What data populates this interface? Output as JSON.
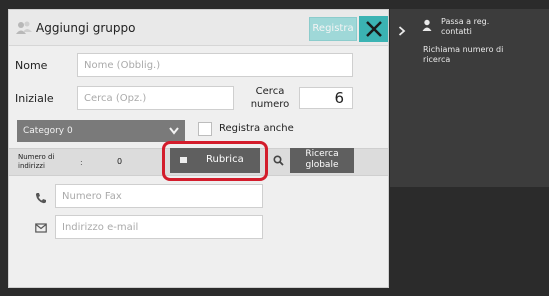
{
  "title_bar": {
    "title": "Aggiungi gruppo",
    "register_button": "Registra",
    "close_icon": "close-icon"
  },
  "form": {
    "name_label": "Nome",
    "name_placeholder": "Nome (Obblig.)",
    "initial_label": "Iniziale",
    "initial_placeholder": "Cerca (Opz.)",
    "search_number_label": "Cerca numero",
    "search_number_value": "6",
    "category_value": "Category 0",
    "register_also_label": "Registra anche",
    "register_also_checked": false
  },
  "address_count": {
    "label": "Numero di indirizzi",
    "colon": ":",
    "value": "0"
  },
  "actions": {
    "rubrica_button": "Rubrica",
    "global_search_button": "Ricerca globale"
  },
  "fields": {
    "fax_placeholder": "Numero Fax",
    "email_placeholder": "Indirizzo e-mail"
  },
  "side_panel": {
    "goto_contacts": "Passa a reg. contatti",
    "recall_search_number": "Richiama numero di ricerca"
  },
  "colors": {
    "accent_teal": "#3bb3b3",
    "highlight_red": "#d31c2b",
    "button_gray": "#5f5f5f"
  }
}
